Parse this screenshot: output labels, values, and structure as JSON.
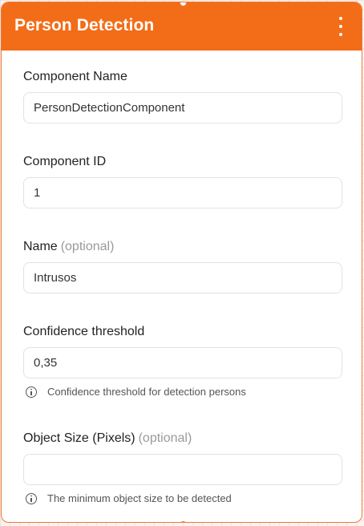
{
  "header": {
    "title": "Person Detection",
    "menu_icon": "kebab-menu-icon",
    "color": "#f36c17"
  },
  "fields": {
    "component_name": {
      "label": "Component Name",
      "value": "PersonDetectionComponent"
    },
    "component_id": {
      "label": "Component ID",
      "value": "1"
    },
    "name": {
      "label": "Name",
      "optional": "(optional)",
      "value": "Intrusos"
    },
    "confidence": {
      "label": "Confidence threshold",
      "value": "0,35",
      "help": "Confidence threshold for detection persons"
    },
    "object_size": {
      "label": "Object Size (Pixels)",
      "optional": "(optional)",
      "value": "",
      "help": "The minimum object size to be detected"
    }
  }
}
